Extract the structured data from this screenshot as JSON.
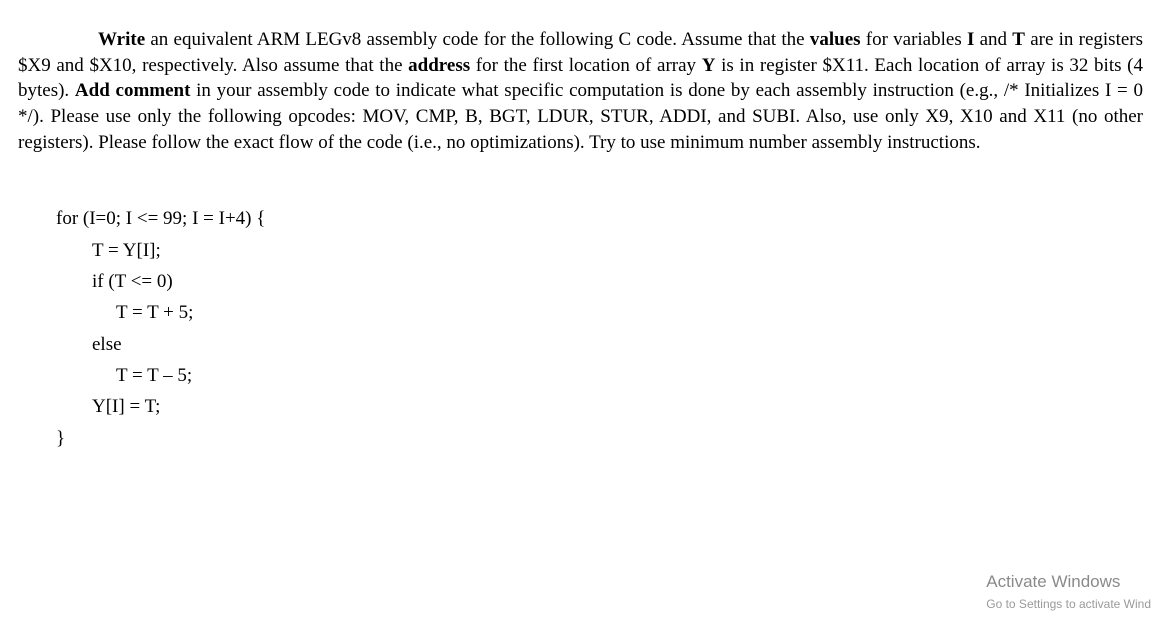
{
  "paragraph": {
    "write": "Write",
    "t1": " an equivalent ARM LEGv8 assembly code for the following C code. Assume that the ",
    "values": "values",
    "t2": " for variables ",
    "ivar": "I",
    "t3": " and ",
    "tvar": "T",
    "t4": " are in registers $X9 and $X10, respectively. Also assume that the ",
    "address": "address",
    "t5": " for the first location of array ",
    "yvar": "Y",
    "t6": " is in register $X11. Each location of array is 32 bits (4 bytes). ",
    "add": "Add comment",
    "t7": " in your assembly code to indicate what specific computation is done by each assembly instruction (e.g., /* Initializes I = 0 */). Please use only the following opcodes: MOV, CMP, B, BGT, LDUR, STUR, ADDI, and SUBI. Also, use only X9, X10 and X11 (no other registers). Please follow the exact flow of the code (i.e., no optimizations). Try to use minimum number assembly instructions."
  },
  "code": {
    "l1": "for (I=0; I <= 99; I = I+4) {",
    "l2": "T = Y[I];",
    "l3": "if (T <= 0)",
    "l4": "T = T + 5;",
    "l5": "else",
    "l6": "T = T – 5;",
    "l7": "Y[I] = T;",
    "l8": "}"
  },
  "watermark": {
    "title": "Activate Windows",
    "sub": "Go to Settings to activate Wind"
  }
}
